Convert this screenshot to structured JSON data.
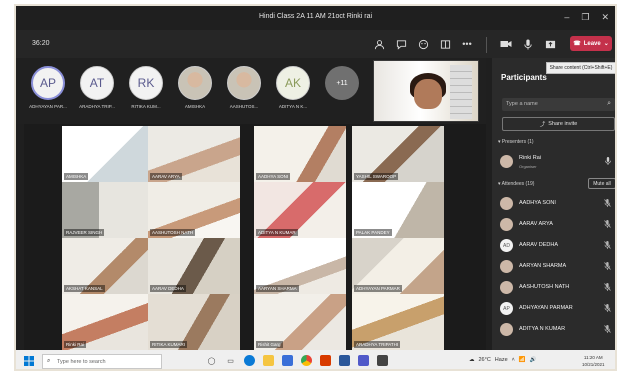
{
  "window": {
    "title": "Hindi Class 2A 11 AM 21oct Rinki rai"
  },
  "toolbar": {
    "timer": "36:20",
    "leave_label": "Leave",
    "tooltip": "Share content (Ctrl+Shift+E)"
  },
  "strip": {
    "avatars": [
      {
        "initials": "AP",
        "name": "ADHYAYAN PAR..."
      },
      {
        "initials": "AT",
        "name": "ARADHYA TRIP..."
      },
      {
        "initials": "RK",
        "name": "RITIKA KUM..."
      },
      {
        "initials": "",
        "name": "AMISHKA"
      },
      {
        "initials": "",
        "name": "AASHUTOS..."
      },
      {
        "initials": "AK",
        "name": "ADITYA N K..."
      },
      {
        "initials": "+11",
        "name": ""
      }
    ]
  },
  "grid": {
    "tiles": [
      "AMISHKA",
      "AARAV ARYA",
      "AADHYA SONI",
      "YASHIL SWAROOP",
      "RAJVEER SINGH",
      "AASHUTOSH NATH",
      "ADITYA N KUMAR",
      "PALAK PANDEY",
      "AKSHAT KANSAL",
      "AARAV DEDHA",
      "AARYAN SHARMA",
      "ADHYAYAN PARMAR",
      "Rinki Rai",
      "RITIKA KUMARI",
      "Rishit Garg",
      "ARADHYA TRIPATHI"
    ]
  },
  "panel": {
    "title": "Participants",
    "search_placeholder": "Type a name",
    "share_invite_label": "Share invite",
    "presenters_label": "Presenters (1)",
    "organizer": {
      "name": "Rinki Rai",
      "role": "Organiser"
    },
    "attendees_label": "Attendees (19)",
    "mute_all_label": "Mute all",
    "attendees": [
      {
        "name": "AADHYA SONI",
        "initials": ""
      },
      {
        "name": "AARAV ARYA",
        "initials": ""
      },
      {
        "name": "AARAV DEDHA",
        "initials": "AD"
      },
      {
        "name": "AARYAN SHARMA",
        "initials": ""
      },
      {
        "name": "AASHUTOSH NATH",
        "initials": ""
      },
      {
        "name": "ADHYAYAN PARMAR",
        "initials": "AP"
      },
      {
        "name": "ADITYA N KUMAR",
        "initials": ""
      }
    ]
  },
  "taskbar": {
    "search_placeholder": "Type here to search",
    "weather": "26°C",
    "haze": "Haze",
    "time": "11:20 AM",
    "date": "10/21/2021"
  },
  "colors": {
    "leave": "#c4314b",
    "panel_bg": "#2b2b2b",
    "accent": "#8a8fd8"
  }
}
